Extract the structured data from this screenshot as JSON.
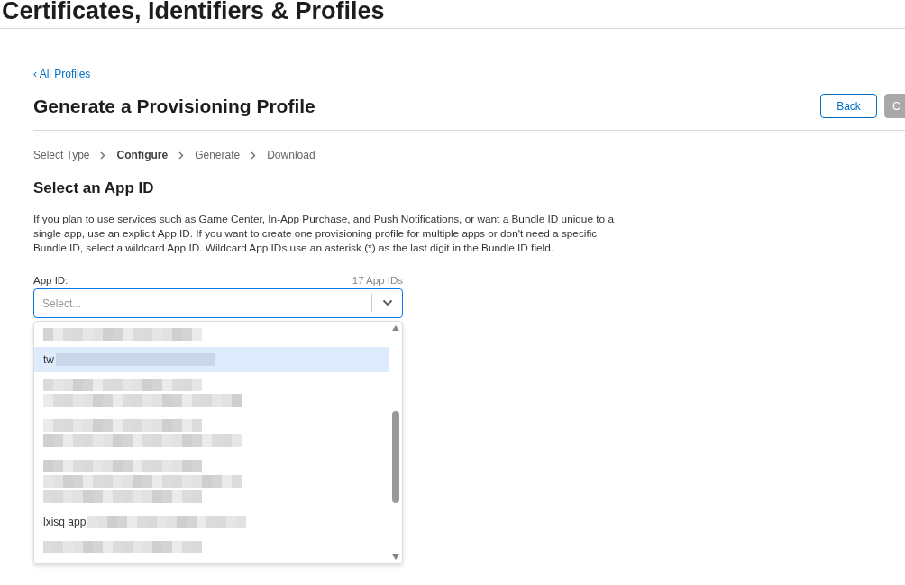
{
  "header": {
    "title": "Certificates, Identifiers & Profiles"
  },
  "back_link": {
    "icon": "‹",
    "label": "All Profiles"
  },
  "page_title": "Generate a Provisioning Profile",
  "buttons": [
    {
      "label": "Back",
      "disabled": false
    },
    {
      "label": "C",
      "disabled": true
    }
  ],
  "steps": [
    {
      "label": "Select Type",
      "selected": false
    },
    {
      "label": "Configure",
      "selected": true
    },
    {
      "label": "Generate",
      "selected": false
    },
    {
      "label": "Download",
      "selected": false
    }
  ],
  "section_title": "Select an App ID",
  "description": "If you plan to use services such as Game Center, In-App Purchase, and Push Notifications, or want a Bundle ID unique to a single app, use an explicit App ID. If you want to create one provisioning profile for multiple apps or don't need a specific Bundle ID, select a wildcard App ID. Wildcard App IDs use an asterisk (*) as the last digit in the Bundle ID field.",
  "app_id_field": {
    "label": "App ID:",
    "count": "17 App IDs",
    "placeholder": "Select...",
    "expanded": true,
    "options": [
      {
        "kind": "single",
        "selected": false
      },
      {
        "kind": "single",
        "prefix": "tw",
        "selected": true
      },
      {
        "kind": "double",
        "selected": false
      },
      {
        "kind": "double",
        "selected": false
      },
      {
        "kind": "triple",
        "selected": false
      },
      {
        "kind": "single",
        "prefix": "lxisq app",
        "selected": false
      },
      {
        "kind": "single",
        "selected": false
      }
    ]
  }
}
